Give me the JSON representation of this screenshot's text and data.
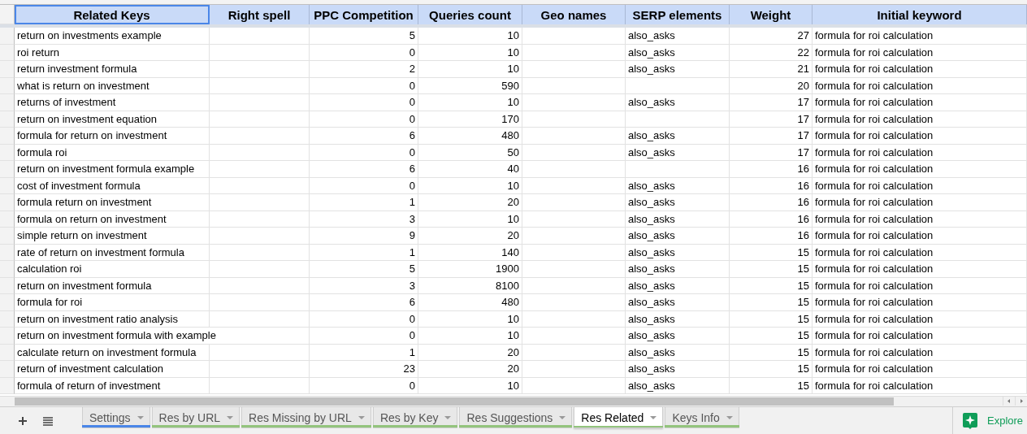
{
  "columns": [
    {
      "label": "Related Keys",
      "selected": true
    },
    {
      "label": "Right spell",
      "selected": false
    },
    {
      "label": "PPC Competition",
      "selected": false
    },
    {
      "label": "Queries count",
      "selected": false
    },
    {
      "label": "Geo names",
      "selected": false
    },
    {
      "label": "SERP elements",
      "selected": false
    },
    {
      "label": "Weight",
      "selected": false
    },
    {
      "label": "Initial keyword",
      "selected": false
    }
  ],
  "rows": [
    {
      "cells": [
        "return on investments example",
        "",
        "5",
        "10",
        "",
        "also_asks",
        "27",
        "formula for roi calculation"
      ]
    },
    {
      "cells": [
        "roi return",
        "",
        "0",
        "10",
        "",
        "also_asks",
        "22",
        "formula for roi calculation"
      ]
    },
    {
      "cells": [
        "return investment formula",
        "",
        "2",
        "10",
        "",
        "also_asks",
        "21",
        "formula for roi calculation"
      ]
    },
    {
      "cells": [
        "what is return on investment",
        "",
        "0",
        "590",
        "",
        "",
        "20",
        "formula for roi calculation"
      ]
    },
    {
      "cells": [
        "returns of investment",
        "",
        "0",
        "10",
        "",
        "also_asks",
        "17",
        "formula for roi calculation"
      ]
    },
    {
      "cells": [
        "return on investment equation",
        "",
        "0",
        "170",
        "",
        "",
        "17",
        "formula for roi calculation"
      ]
    },
    {
      "cells": [
        "formula for return on investment",
        "",
        "6",
        "480",
        "",
        "also_asks",
        "17",
        "formula for roi calculation"
      ]
    },
    {
      "cells": [
        "formula roi",
        "",
        "0",
        "50",
        "",
        "also_asks",
        "17",
        "formula for roi calculation"
      ]
    },
    {
      "cells": [
        "return on investment formula example",
        "",
        "6",
        "40",
        "",
        "",
        "16",
        "formula for roi calculation"
      ]
    },
    {
      "cells": [
        "cost of investment formula",
        "",
        "0",
        "10",
        "",
        "also_asks",
        "16",
        "formula for roi calculation"
      ]
    },
    {
      "cells": [
        "formula return on investment",
        "",
        "1",
        "20",
        "",
        "also_asks",
        "16",
        "formula for roi calculation"
      ]
    },
    {
      "cells": [
        "formula on return on investment",
        "",
        "3",
        "10",
        "",
        "also_asks",
        "16",
        "formula for roi calculation"
      ]
    },
    {
      "cells": [
        "simple return on investment",
        "",
        "9",
        "20",
        "",
        "also_asks",
        "16",
        "formula for roi calculation"
      ]
    },
    {
      "cells": [
        "rate of return on investment formula",
        "",
        "1",
        "140",
        "",
        "also_asks",
        "15",
        "formula for roi calculation"
      ]
    },
    {
      "cells": [
        "calculation roi",
        "",
        "5",
        "1900",
        "",
        "also_asks",
        "15",
        "formula for roi calculation"
      ]
    },
    {
      "cells": [
        "return on investment formula",
        "",
        "3",
        "8100",
        "",
        "also_asks",
        "15",
        "formula for roi calculation"
      ]
    },
    {
      "cells": [
        "formula for roi",
        "",
        "6",
        "480",
        "",
        "also_asks",
        "15",
        "formula for roi calculation"
      ]
    },
    {
      "cells": [
        "return on investment ratio analysis",
        "",
        "0",
        "10",
        "",
        "also_asks",
        "15",
        "formula for roi calculation"
      ]
    },
    {
      "cells": [
        "return on investment formula with example",
        "",
        "0",
        "10",
        "",
        "also_asks",
        "15",
        "formula for roi calculation"
      ]
    },
    {
      "cells": [
        "calculate return on investment formula",
        "",
        "1",
        "20",
        "",
        "also_asks",
        "15",
        "formula for roi calculation"
      ]
    },
    {
      "cells": [
        "return of investment calculation",
        "",
        "23",
        "20",
        "",
        "also_asks",
        "15",
        "formula for roi calculation"
      ]
    },
    {
      "cells": [
        "formula of return of investment",
        "",
        "0",
        "10",
        "",
        "also_asks",
        "15",
        "formula for roi calculation"
      ]
    }
  ],
  "sheet_tabs": [
    {
      "label": "Settings",
      "color": "#4a86e8",
      "selected": false
    },
    {
      "label": "Res by URL",
      "color": "#93c47d",
      "selected": false
    },
    {
      "label": "Res Missing by URL",
      "color": "#93c47d",
      "selected": false
    },
    {
      "label": "Res by Key",
      "color": "#93c47d",
      "selected": false
    },
    {
      "label": "Res Suggestions",
      "color": "#93c47d",
      "selected": false
    },
    {
      "label": "Res Related",
      "color": "#93c47d",
      "selected": true
    },
    {
      "label": "Keys Info",
      "color": "#93c47d",
      "selected": false
    }
  ],
  "explore": {
    "label": "Explore"
  }
}
